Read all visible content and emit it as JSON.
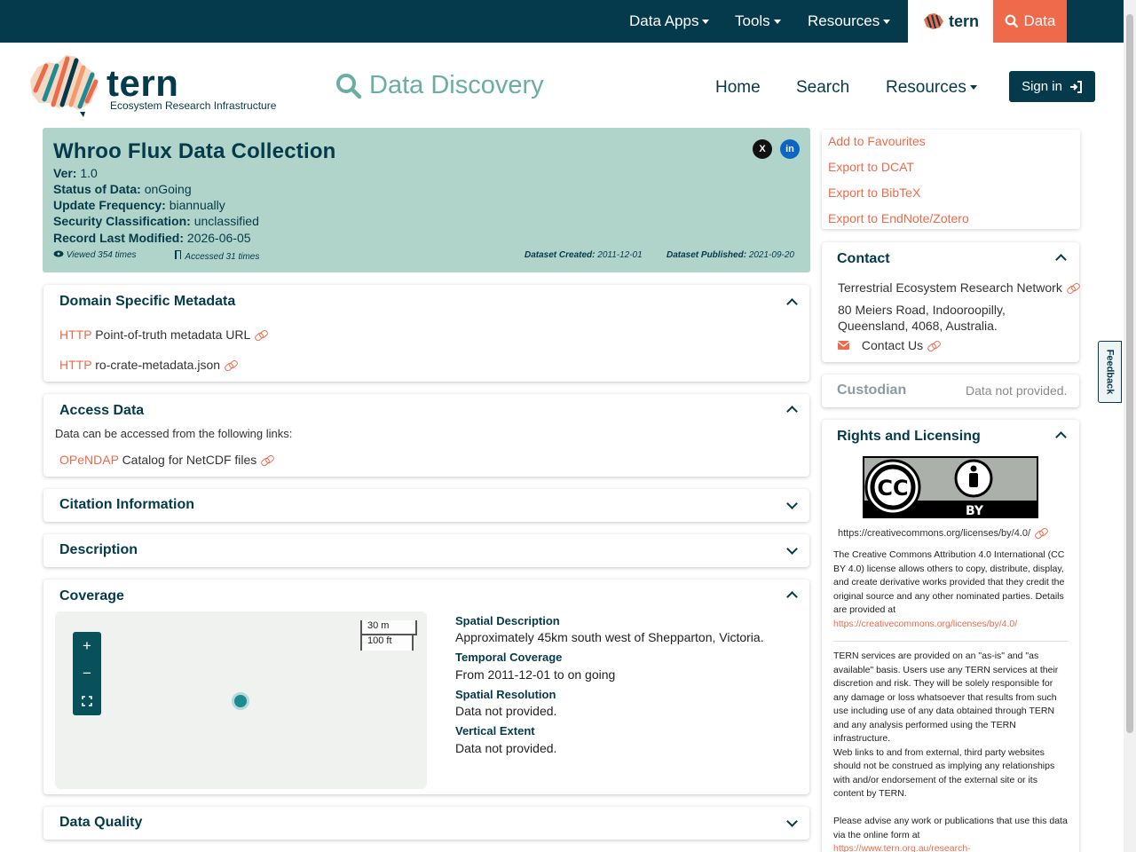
{
  "topnav": {
    "items": [
      "Data Apps",
      "Tools",
      "Resources"
    ],
    "tern_tab": "tern",
    "data_tab": "Data"
  },
  "branding": {
    "logo_name": "tern",
    "logo_subtitle": "Ecosystem Research Infrastructure",
    "app_title": "Data Discovery"
  },
  "mainnav": {
    "home": "Home",
    "search": "Search",
    "resources": "Resources",
    "signin": "Sign in"
  },
  "record": {
    "title": "Whroo Flux Data Collection",
    "fields": [
      {
        "label": "Ver:",
        "value": "1.0"
      },
      {
        "label": "Status of Data:",
        "value": "onGoing"
      },
      {
        "label": "Update Frequency:",
        "value": "biannually"
      },
      {
        "label": "Security Classification:",
        "value": "unclassified"
      },
      {
        "label": "Record Last Modified:",
        "value": "2026-06-05"
      }
    ],
    "viewed": "Viewed 354 times",
    "accessed": "Accessed 31 times",
    "created_label": "Dataset Created:",
    "created": "2011-12-01",
    "published_label": "Dataset Published:",
    "published": "2021-09-20",
    "social": [
      "X",
      "in"
    ]
  },
  "actions": [
    "Add to Favourites",
    "Export to DCAT",
    "Export to BibTeX",
    "Export to EndNote/Zotero"
  ],
  "domain_metadata": {
    "title": "Domain Specific Metadata",
    "links": [
      {
        "protocol": "HTTP",
        "label": "Point-of-truth metadata URL"
      },
      {
        "protocol": "HTTP",
        "label": "ro-crate-metadata.json"
      }
    ]
  },
  "access_data": {
    "title": "Access Data",
    "intro": "Data can be accessed from the following links:",
    "links": [
      {
        "protocol": "OPeNDAP",
        "label": "Catalog for NetCDF files"
      }
    ]
  },
  "collapsed_sections": [
    "Citation Information",
    "Description"
  ],
  "coverage": {
    "title": "Coverage",
    "scale_m": "30 m",
    "scale_ft": "100 ft",
    "items": [
      {
        "label": "Spatial Description",
        "value": "Approximately 45km south west of Shepparton, Victoria."
      },
      {
        "label": "Temporal Coverage",
        "value": "From 2011-12-01 to on going"
      },
      {
        "label": "Spatial Resolution",
        "value": "Data not provided."
      },
      {
        "label": "Vertical Extent",
        "value": "Data not provided."
      }
    ]
  },
  "data_quality": {
    "title": "Data Quality"
  },
  "contact": {
    "title": "Contact",
    "org": "Terrestrial Ecosystem Research Network",
    "address": "80 Meiers Road, Indooroopilly, Queensland, 4068, Australia.",
    "contact_us": "Contact Us"
  },
  "custodian": {
    "title": "Custodian",
    "value": "Data not provided."
  },
  "rights": {
    "title": "Rights and Licensing",
    "license_badge": "BY",
    "license_url": "https://creativecommons.org/licenses/by/4.0/",
    "description": "The Creative Commons Attribution 4.0 International (CC BY 4.0) license allows others to copy, distribute, display, and create derivative works provided that they credit the original source and any other nominated parties. Details are provided at",
    "description_link": "https://creativecommons.org/licenses/by/4.0/",
    "disclaimer_1": "TERN services are provided on an \"as-is\" and \"as available\" basis. Users use any TERN services at their discretion and risk. They will be solely responsible for any damage or loss whatsoever that results from such use including use of any data obtained through TERN and any analysis performed using the TERN infrastructure.",
    "disclaimer_2": "Web links to and from external, third party websites should not be construed as implying any relationships with and/or endorsement of the external site or its content by TERN.",
    "advise": "Please advise any work or publications that use this data via the online form at",
    "advise_link": "https://www.tern.org.au/research-"
  },
  "feedback": "Feedback",
  "colors": {
    "primary": "#043a4b",
    "accent": "#ee6a4a",
    "header_bg": "#b0d4c9",
    "teal": "#6aada3"
  }
}
